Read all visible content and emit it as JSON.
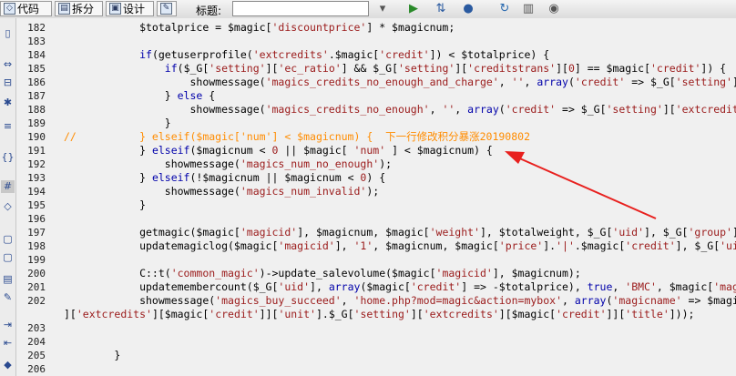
{
  "toolbar": {
    "code": "代码",
    "split": "拆分",
    "design": "设计",
    "title_label": "标题:",
    "title_value": ""
  },
  "line_numbers": [
    "182",
    "183",
    "184",
    "185",
    "186",
    "187",
    "188",
    "189",
    "190",
    "191",
    "192",
    "193",
    "194",
    "195",
    "196",
    "197",
    "198",
    "199",
    "200",
    "201",
    "202",
    "",
    "203",
    "204",
    "205",
    "206"
  ],
  "code_lines": [
    "            $totalprice = $magic['discountprice'] * $magicnum;",
    "",
    "            if(getuserprofile('extcredits'.$magic['credit']) < $totalprice) {",
    "                if($_G['setting']['ec_ratio'] && $_G['setting']['creditstrans'][0] == $magic['credit']) {",
    "                    showmessage('magics_credits_no_enough_and_charge', '', array('credit' => $_G['setting']['extcredits'",
    "                } else {",
    "                    showmessage('magics_credits_no_enough', '', array('credit' => $_G['setting']['extcredits'][$magic",
    "                }",
    "//          } elseif($magic['num'] < $magicnum) {  下一行修改积分暴涨20190802",
    "            } elseif($magicnum < 0 || $magic[ 'num' ] < $magicnum) {",
    "                showmessage('magics_num_no_enough');",
    "            } elseif(!$magicnum || $magicnum < 0) {",
    "                showmessage('magics_num_invalid');",
    "            }",
    "",
    "            getmagic($magic['magicid'], $magicnum, $magic['weight'], $totalweight, $_G['uid'], $_G['group']['maxm",
    "            updatemagiclog($magic['magicid'], '1', $magicnum, $magic['price'].'|'.$magic['credit'], $_G['uid']);",
    "",
    "            C::t('common_magic')->update_salevolume($magic['magicid'], $magicnum);",
    "            updatemembercount($_G['uid'], array($magic['credit'] => -$totalprice), true, 'BMC', $magic['magicid'",
    "            showmessage('magics_buy_succeed', 'home.php?mod=magic&action=mybox', array('magicname' => $magic['n",
    "]['extcredits'][$magic['credit']]['unit'].$_G['setting']['extcredits'][$magic['credit']]['title']));",
    "",
    "",
    "        }",
    ""
  ]
}
